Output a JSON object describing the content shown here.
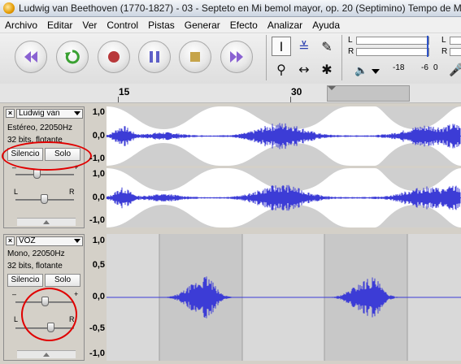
{
  "window": {
    "title": "Ludwig van Beethoven (1770-1827) - 03 - Septeto en Mi bemol mayor, op. 20 (Septimino) Tempo de M"
  },
  "menu": [
    "Archivo",
    "Editar",
    "Ver",
    "Control",
    "Pistas",
    "Generar",
    "Efecto",
    "Analizar",
    "Ayuda"
  ],
  "transport": {
    "buttons": [
      {
        "name": "skip-start",
        "color": "#8a62d2"
      },
      {
        "name": "loop",
        "color": "#3aa132"
      },
      {
        "name": "record",
        "color": "#b8383a"
      },
      {
        "name": "pause",
        "color": "#5d5fc7"
      },
      {
        "name": "stop",
        "color": "#c6a44a"
      },
      {
        "name": "skip-end",
        "color": "#8a62d2"
      }
    ]
  },
  "tools": {
    "select": "I",
    "envelope": "≚",
    "draw": "✎",
    "zoom": "⚲",
    "timeshift": "↔",
    "multi": "✱"
  },
  "meters": {
    "left": "L",
    "right": "R",
    "ticks": [
      "-18",
      "-6",
      "0"
    ]
  },
  "ruler": {
    "labels": [
      "15",
      "30"
    ]
  },
  "tracks": [
    {
      "name": "Ludwig van",
      "info1": "Estéreo, 22050Hz",
      "info2": "32 bits, flotante",
      "mute": "Silencio",
      "solo": "Solo",
      "gain_minus": "–",
      "gain_plus": "+",
      "pan_l": "L",
      "pan_r": "R",
      "scale_top": [
        "1,0",
        "0,0",
        "-1,0"
      ],
      "scale_bottom": [
        "1,0",
        "0,0",
        "-1,0"
      ]
    },
    {
      "name": "VOZ",
      "info1": "Mono, 22050Hz",
      "info2": "32 bits, flotante",
      "mute": "Silencio",
      "solo": "Solo",
      "gain_minus": "–",
      "gain_plus": "+",
      "pan_l": "L",
      "pan_r": "R",
      "scale": [
        "1,0",
        "0,5",
        "0,0",
        "-0,5",
        "-1,0"
      ]
    }
  ],
  "colors": {
    "waveform": "#3c3cd6",
    "envelope_bg": "#cfcfcf",
    "annotation": "#e00000"
  }
}
